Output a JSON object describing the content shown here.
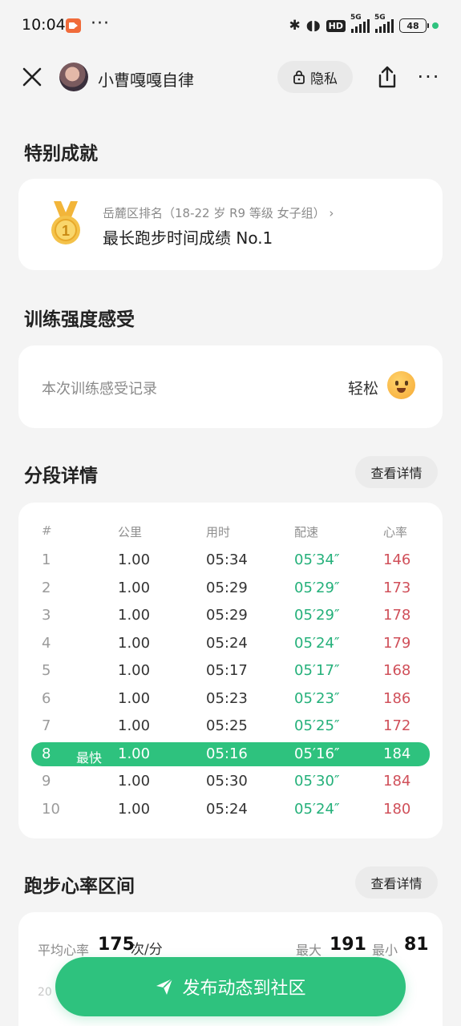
{
  "status_bar": {
    "time": "10:04",
    "more": "···",
    "network_1": "5G",
    "network_2": "5G",
    "hd": "HD",
    "battery": "48"
  },
  "header": {
    "user_name": "小曹嘎嘎自律",
    "privacy_label": "隐私",
    "more_label": "···"
  },
  "achievement": {
    "section_title": "特别成就",
    "subtitle": "岳麓区排名（18-22 岁 R9 等级 女子组）",
    "title": "最长跑步时间成绩 No.1",
    "medal_number": "1"
  },
  "feel": {
    "section_title": "训练强度感受",
    "label": "本次训练感受记录",
    "value": "轻松"
  },
  "splits": {
    "section_title": "分段详情",
    "detail_button": "查看详情",
    "headers": [
      "#",
      "公里",
      "用时",
      "配速",
      "心率"
    ],
    "best_label": "最快",
    "rows": [
      {
        "num": "1",
        "km": "1.00",
        "time": "05:34",
        "pace": "05′34″",
        "hr": "146"
      },
      {
        "num": "2",
        "km": "1.00",
        "time": "05:29",
        "pace": "05′29″",
        "hr": "173"
      },
      {
        "num": "3",
        "km": "1.00",
        "time": "05:29",
        "pace": "05′29″",
        "hr": "178"
      },
      {
        "num": "4",
        "km": "1.00",
        "time": "05:24",
        "pace": "05′24″",
        "hr": "179"
      },
      {
        "num": "5",
        "km": "1.00",
        "time": "05:17",
        "pace": "05′17″",
        "hr": "168"
      },
      {
        "num": "6",
        "km": "1.00",
        "time": "05:23",
        "pace": "05′23″",
        "hr": "186"
      },
      {
        "num": "7",
        "km": "1.00",
        "time": "05:25",
        "pace": "05′25″",
        "hr": "172"
      },
      {
        "num": "8",
        "km": "1.00",
        "time": "05:16",
        "pace": "05′16″",
        "hr": "184"
      },
      {
        "num": "9",
        "km": "1.00",
        "time": "05:30",
        "pace": "05′30″",
        "hr": "184"
      },
      {
        "num": "10",
        "km": "1.00",
        "time": "05:24",
        "pace": "05′24″",
        "hr": "180"
      }
    ]
  },
  "heart_rate": {
    "section_title": "跑步心率区间",
    "detail_button": "查看详情",
    "avg_label": "平均心率",
    "avg_value": "175",
    "avg_unit": "次/分",
    "max_label": "最大",
    "max_value": "191",
    "min_label": "最小",
    "min_value": "81",
    "axis_start": "20"
  },
  "publish_button": "发布动态到社区",
  "colors": {
    "accent": "#2ec27e",
    "pace": "#24b07a",
    "heart_rate": "#d0505a"
  }
}
